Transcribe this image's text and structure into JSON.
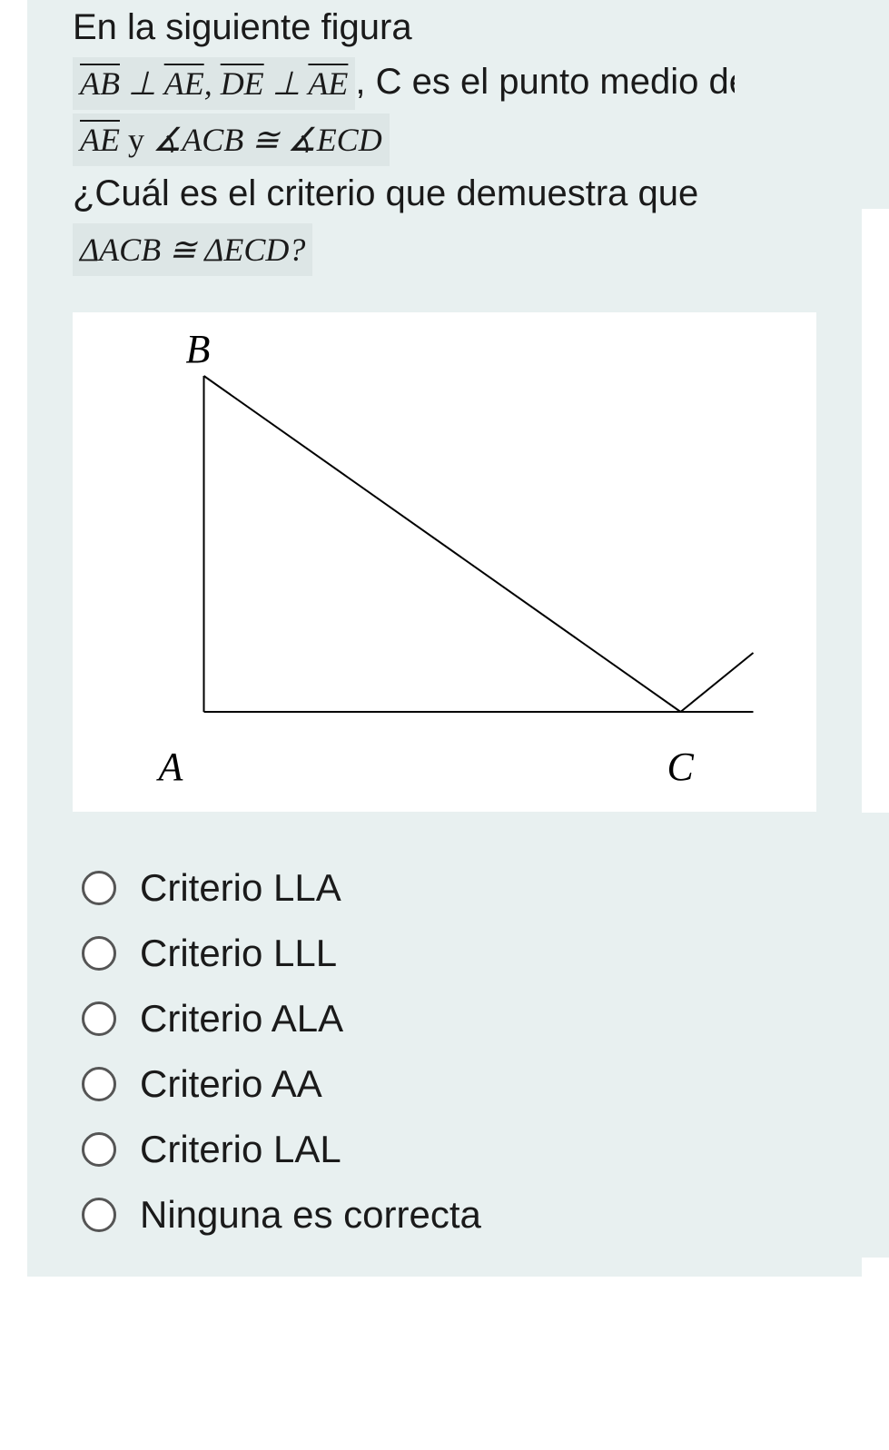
{
  "question": {
    "line1_prefix": "En la siguiente figura",
    "math1": "AB ⊥ AE, DE ⊥ AE",
    "line2_mid": ",  C es el punto medio de ",
    "math2": "AE y ∡ACB ≅ ∡ECD",
    "line3": "¿Cuál es el criterio que demuestra que ",
    "math3": "ΔACB ≅ ΔECD?"
  },
  "figure": {
    "labels": {
      "B": "B",
      "A": "A",
      "C": "C"
    }
  },
  "options": [
    {
      "label": "Criterio LLA"
    },
    {
      "label": "Criterio LLL"
    },
    {
      "label": "Criterio ALA"
    },
    {
      "label": "Criterio AA"
    },
    {
      "label": "Criterio LAL"
    },
    {
      "label": "Ninguna es correcta"
    }
  ]
}
